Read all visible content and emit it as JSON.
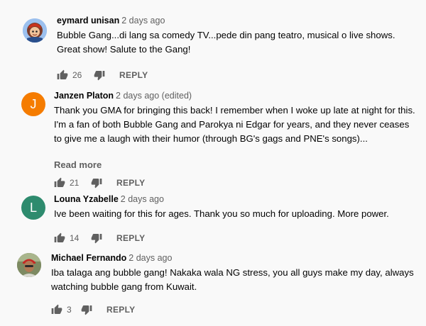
{
  "comments": [
    {
      "author": "eymard unisan",
      "time": "2 days ago",
      "text": "Bubble Gang...di lang sa comedy TV...pede din pang teatro, musical o live shows. Great show! Salute to the Gang!",
      "likes": "26",
      "reply_label": "REPLY",
      "avatar_icon": "cartoon-avatar-icon"
    },
    {
      "author": "Janzen Platon",
      "time": "2 days ago (edited)",
      "text": "Thank you GMA for bringing this back! I remember when I woke up late at night for this. I'm a fan of both Bubble Gang and Parokya ni Edgar for years, and they never ceases to give me a laugh with their humor (through BG's gags and PNE's songs)...",
      "read_more": "Read more",
      "likes": "21",
      "reply_label": "REPLY",
      "avatar_letter": "J",
      "avatar_color": "#f57c00"
    },
    {
      "author": "Louna Yzabelle",
      "time": "2 days ago",
      "text": "Ive been waiting for this for ages. Thank you so much for uploading. More power.",
      "likes": "14",
      "reply_label": "REPLY",
      "avatar_letter": "L",
      "avatar_color": "#2e8b6e"
    },
    {
      "author": "Michael Fernando",
      "time": "2 days ago",
      "text": "Iba talaga ang bubble gang! Nakaka wala NG stress, you all guys make my day, always watching bubble gang from Kuwait.",
      "likes": "3",
      "reply_label": "REPLY",
      "avatar_icon": "photo-avatar-icon"
    }
  ]
}
